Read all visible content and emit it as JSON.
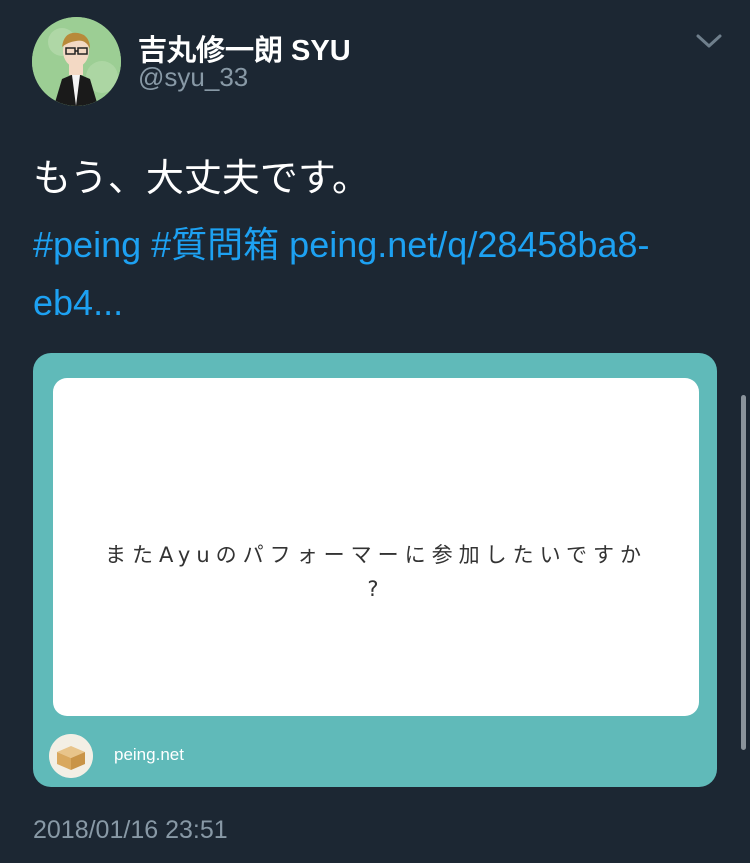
{
  "tweet": {
    "display_name": "吉丸修一朗 SYU",
    "handle": "@syu_33",
    "text": "もう、大丈夫です。",
    "hashtags": [
      "#peing",
      "#質問箱"
    ],
    "link_text": "peing.net/q/28458ba8-eb4...",
    "timestamp": "2018/01/16 23:51"
  },
  "card": {
    "question_line1": "またAyuのパフォーマーに参加したいですか",
    "question_line2": "?",
    "domain": "peing.net"
  },
  "icons": {
    "menu": "chevron-down-icon",
    "avatar": "avatar",
    "card_logo": "cardboard-box-icon"
  },
  "colors": {
    "background": "#1c2733",
    "link": "#1da1f2",
    "muted": "#8899a6",
    "card": "#60bab9"
  }
}
